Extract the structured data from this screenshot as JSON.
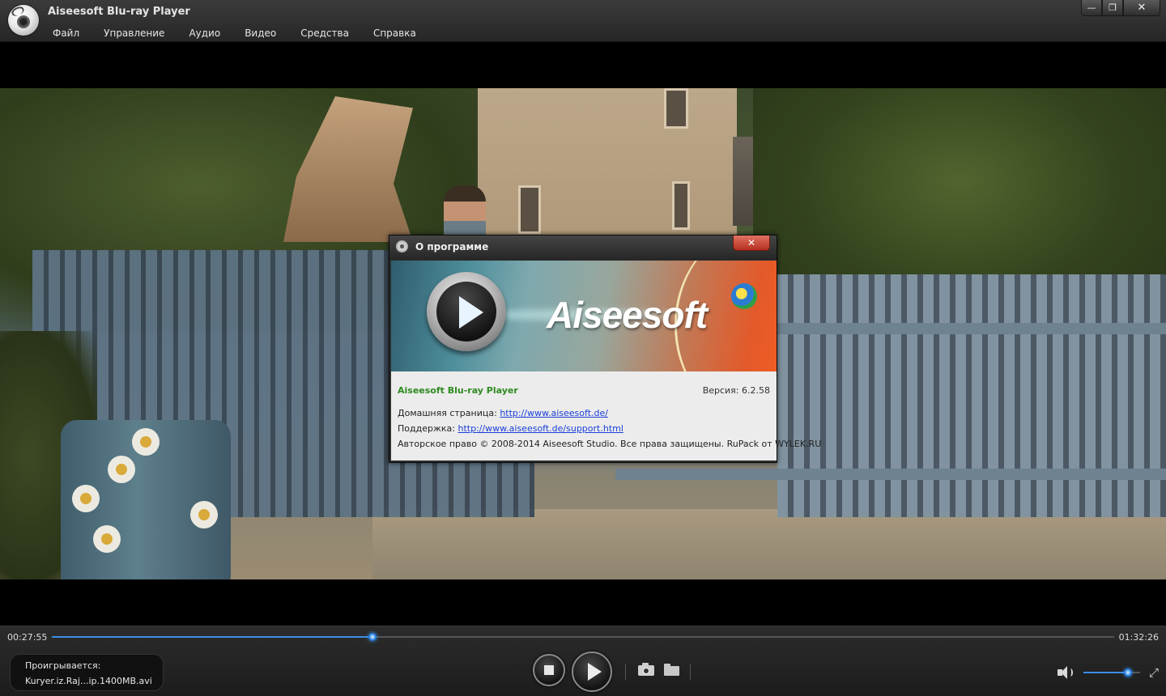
{
  "window": {
    "title": "Aiseesoft Blu-ray Player",
    "minimize_icon": "minimize-icon",
    "maximize_icon": "restore-icon",
    "close_icon": "close-icon",
    "minimize_glyph": "—",
    "restore_glyph": "❐",
    "close_glyph": "✕"
  },
  "menu": {
    "items": [
      "Файл",
      "Управление",
      "Аудио",
      "Видео",
      "Средства",
      "Справка"
    ]
  },
  "about_dialog": {
    "title": "О программе",
    "close_glyph": "✕",
    "banner_brand": "Aiseesoft",
    "product_name": "Aiseesoft Blu-ray Player",
    "version_label": "Версия: 6.2.58",
    "homepage_label": "Домашняя страница:",
    "homepage_url": "http://www.aiseesoft.de/",
    "support_label": "Поддержка:",
    "support_url": "http://www.aiseesoft.de/support.html",
    "copyright": "Авторское право © 2008-2014 Aiseesoft Studio. Все права защищены. RuPack от WYLEK.RU"
  },
  "player": {
    "current_time": "00:27:55",
    "total_time": "01:32:26",
    "progress_fraction": 0.302,
    "volume_fraction": 0.78,
    "now_playing_label": "Проигрывается:",
    "now_playing_file": "Kuryer.iz.Raj...ip.1400MB.avi",
    "fullscreen_glyph": "⤢"
  },
  "colors": {
    "accent": "#3a8ee6",
    "product_name": "#2d8a1f",
    "link": "#1a3fd8",
    "dialog_close": "#c9402e"
  }
}
